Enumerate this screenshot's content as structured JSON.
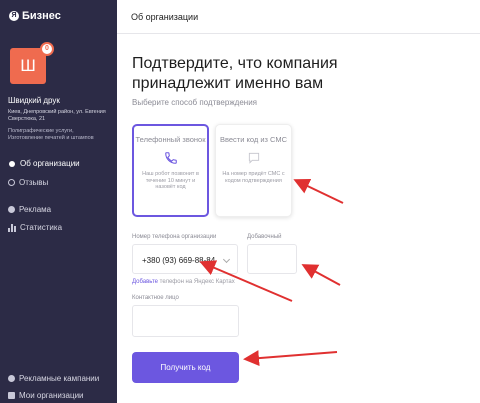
{
  "brand": {
    "logo_letter": "Я",
    "name": "Бизнес"
  },
  "company": {
    "avatar_letter": "Ш",
    "badge": "0",
    "name": "Швидкий друк",
    "address": "Киев, Днепровский район, ул. Евгения Сверстюка, 21",
    "categories": "Полиграфические услуги, Изготовление печатей и штампов"
  },
  "nav": {
    "about": "Об организации",
    "reviews": "Отзывы",
    "ads": "Реклама",
    "stats": "Статистика",
    "campaigns": "Рекламные кампании",
    "my_orgs": "Мои организации"
  },
  "header": {
    "title": "Об организации"
  },
  "main": {
    "heading": "Подтвердите, что компания принадлежит именно вам",
    "subheading": "Выберите способ подтверждения",
    "options": [
      {
        "title": "Телефонный звонок",
        "icon": "phone-icon",
        "desc": "Наш робот позвонит в течение 10 минут и назовёт код"
      },
      {
        "title": "Ввести код из СМС",
        "icon": "message-icon",
        "desc": "На номер придёт СМС с кодом подтверждения"
      }
    ],
    "phone_label": "Номер телефона организации",
    "phone_value": "+380 (93) 669-88-84",
    "ext_label": "Добавочный",
    "add_link": "Добавьте",
    "add_link_rest": "телефон на Яндекс Картах",
    "contact_label": "Контактное лицо",
    "submit": "Получить код"
  },
  "colors": {
    "sidebar": "#2c2b46",
    "accent": "#6c57e0",
    "avatar": "#ef6b4f",
    "annotation_arrow": "#e03030"
  }
}
